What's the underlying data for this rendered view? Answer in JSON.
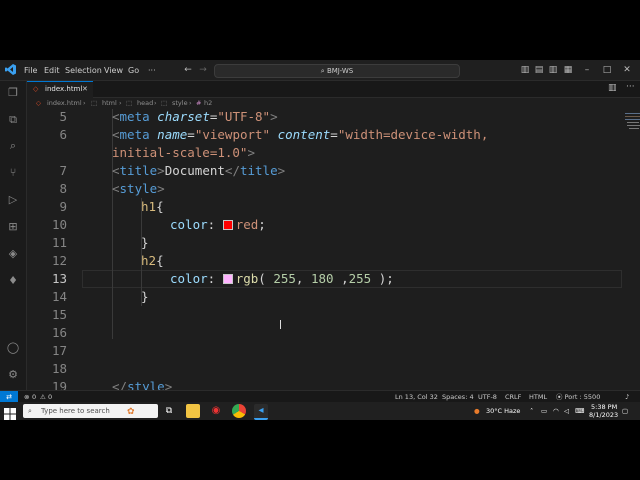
{
  "titlebar": {
    "menu": [
      "File",
      "Edit",
      "Selection",
      "View",
      "Go",
      "···"
    ],
    "search_text": "BMJ-WS"
  },
  "tab": {
    "filename": "index.html"
  },
  "breadcrumb": {
    "file": "index.html",
    "html": "html",
    "head": "head",
    "style": "style",
    "h2": "h2"
  },
  "editor": {
    "line_numbers": [
      "5",
      "6",
      "",
      "7",
      "8",
      "9",
      "10",
      "11",
      "12",
      "13",
      "14",
      "15",
      "16",
      "17",
      "18",
      "19"
    ],
    "line5": {
      "open": "<",
      "tag": "meta",
      "attr": "charset",
      "eq": "=",
      "val": "\"UTF-8\"",
      "close": ">"
    },
    "line6": {
      "open": "<",
      "tag": "meta",
      "attr1": "name",
      "eq1": "=",
      "val1": "\"viewport\"",
      "attr2": "content",
      "eq2": "=",
      "val2": "\"width=device-width,"
    },
    "line6b": {
      "val": "initial-scale=1.0\"",
      "close": ">"
    },
    "line7": {
      "open": "<",
      "tag": "title",
      "close": ">",
      "text": "Document",
      "endopen": "</",
      "endtag": "title",
      "endclose": ">"
    },
    "line8": {
      "open": "<",
      "tag": "style",
      "close": ">"
    },
    "line9": {
      "sel": "h1",
      "brace": "{"
    },
    "line10": {
      "prop": "color",
      "colon": ":",
      "val": "red",
      "semi": ";",
      "swatch": "#ff0000"
    },
    "line11": {
      "brace": "}"
    },
    "line12": {
      "sel": "h2",
      "brace": "{"
    },
    "line13": {
      "prop": "color",
      "colon": ":",
      "fn": "rgb",
      "p1": "(",
      "n1": "255",
      "c1": ",",
      "n2": "180",
      "c2": ",",
      "n3": "255",
      "p2": ")",
      "semi": ";",
      "swatch": "#ffb4ff"
    },
    "line14": {
      "brace": "}"
    },
    "line19": {
      "open": "</",
      "tag": "style",
      "close": ">"
    }
  },
  "statusbar": {
    "errors": "0",
    "warnings": "0",
    "position": "Ln 13, Col 32",
    "spaces": "Spaces: 4",
    "encoding": "UTF-8",
    "eol": "CRLF",
    "language": "HTML",
    "port": "Port : 5500"
  },
  "taskbar": {
    "search_placeholder": "Type here to search",
    "weather": "30°C  Haze",
    "time": "5:38 PM",
    "date": "8/1/2023"
  },
  "colors": {
    "accent": "#0078d4",
    "editor_bg": "#1e1e1e",
    "tag": "#569cd6",
    "string": "#ce9178",
    "selector": "#d7ba7d",
    "property": "#9cdcfe",
    "number": "#b5cea8"
  }
}
